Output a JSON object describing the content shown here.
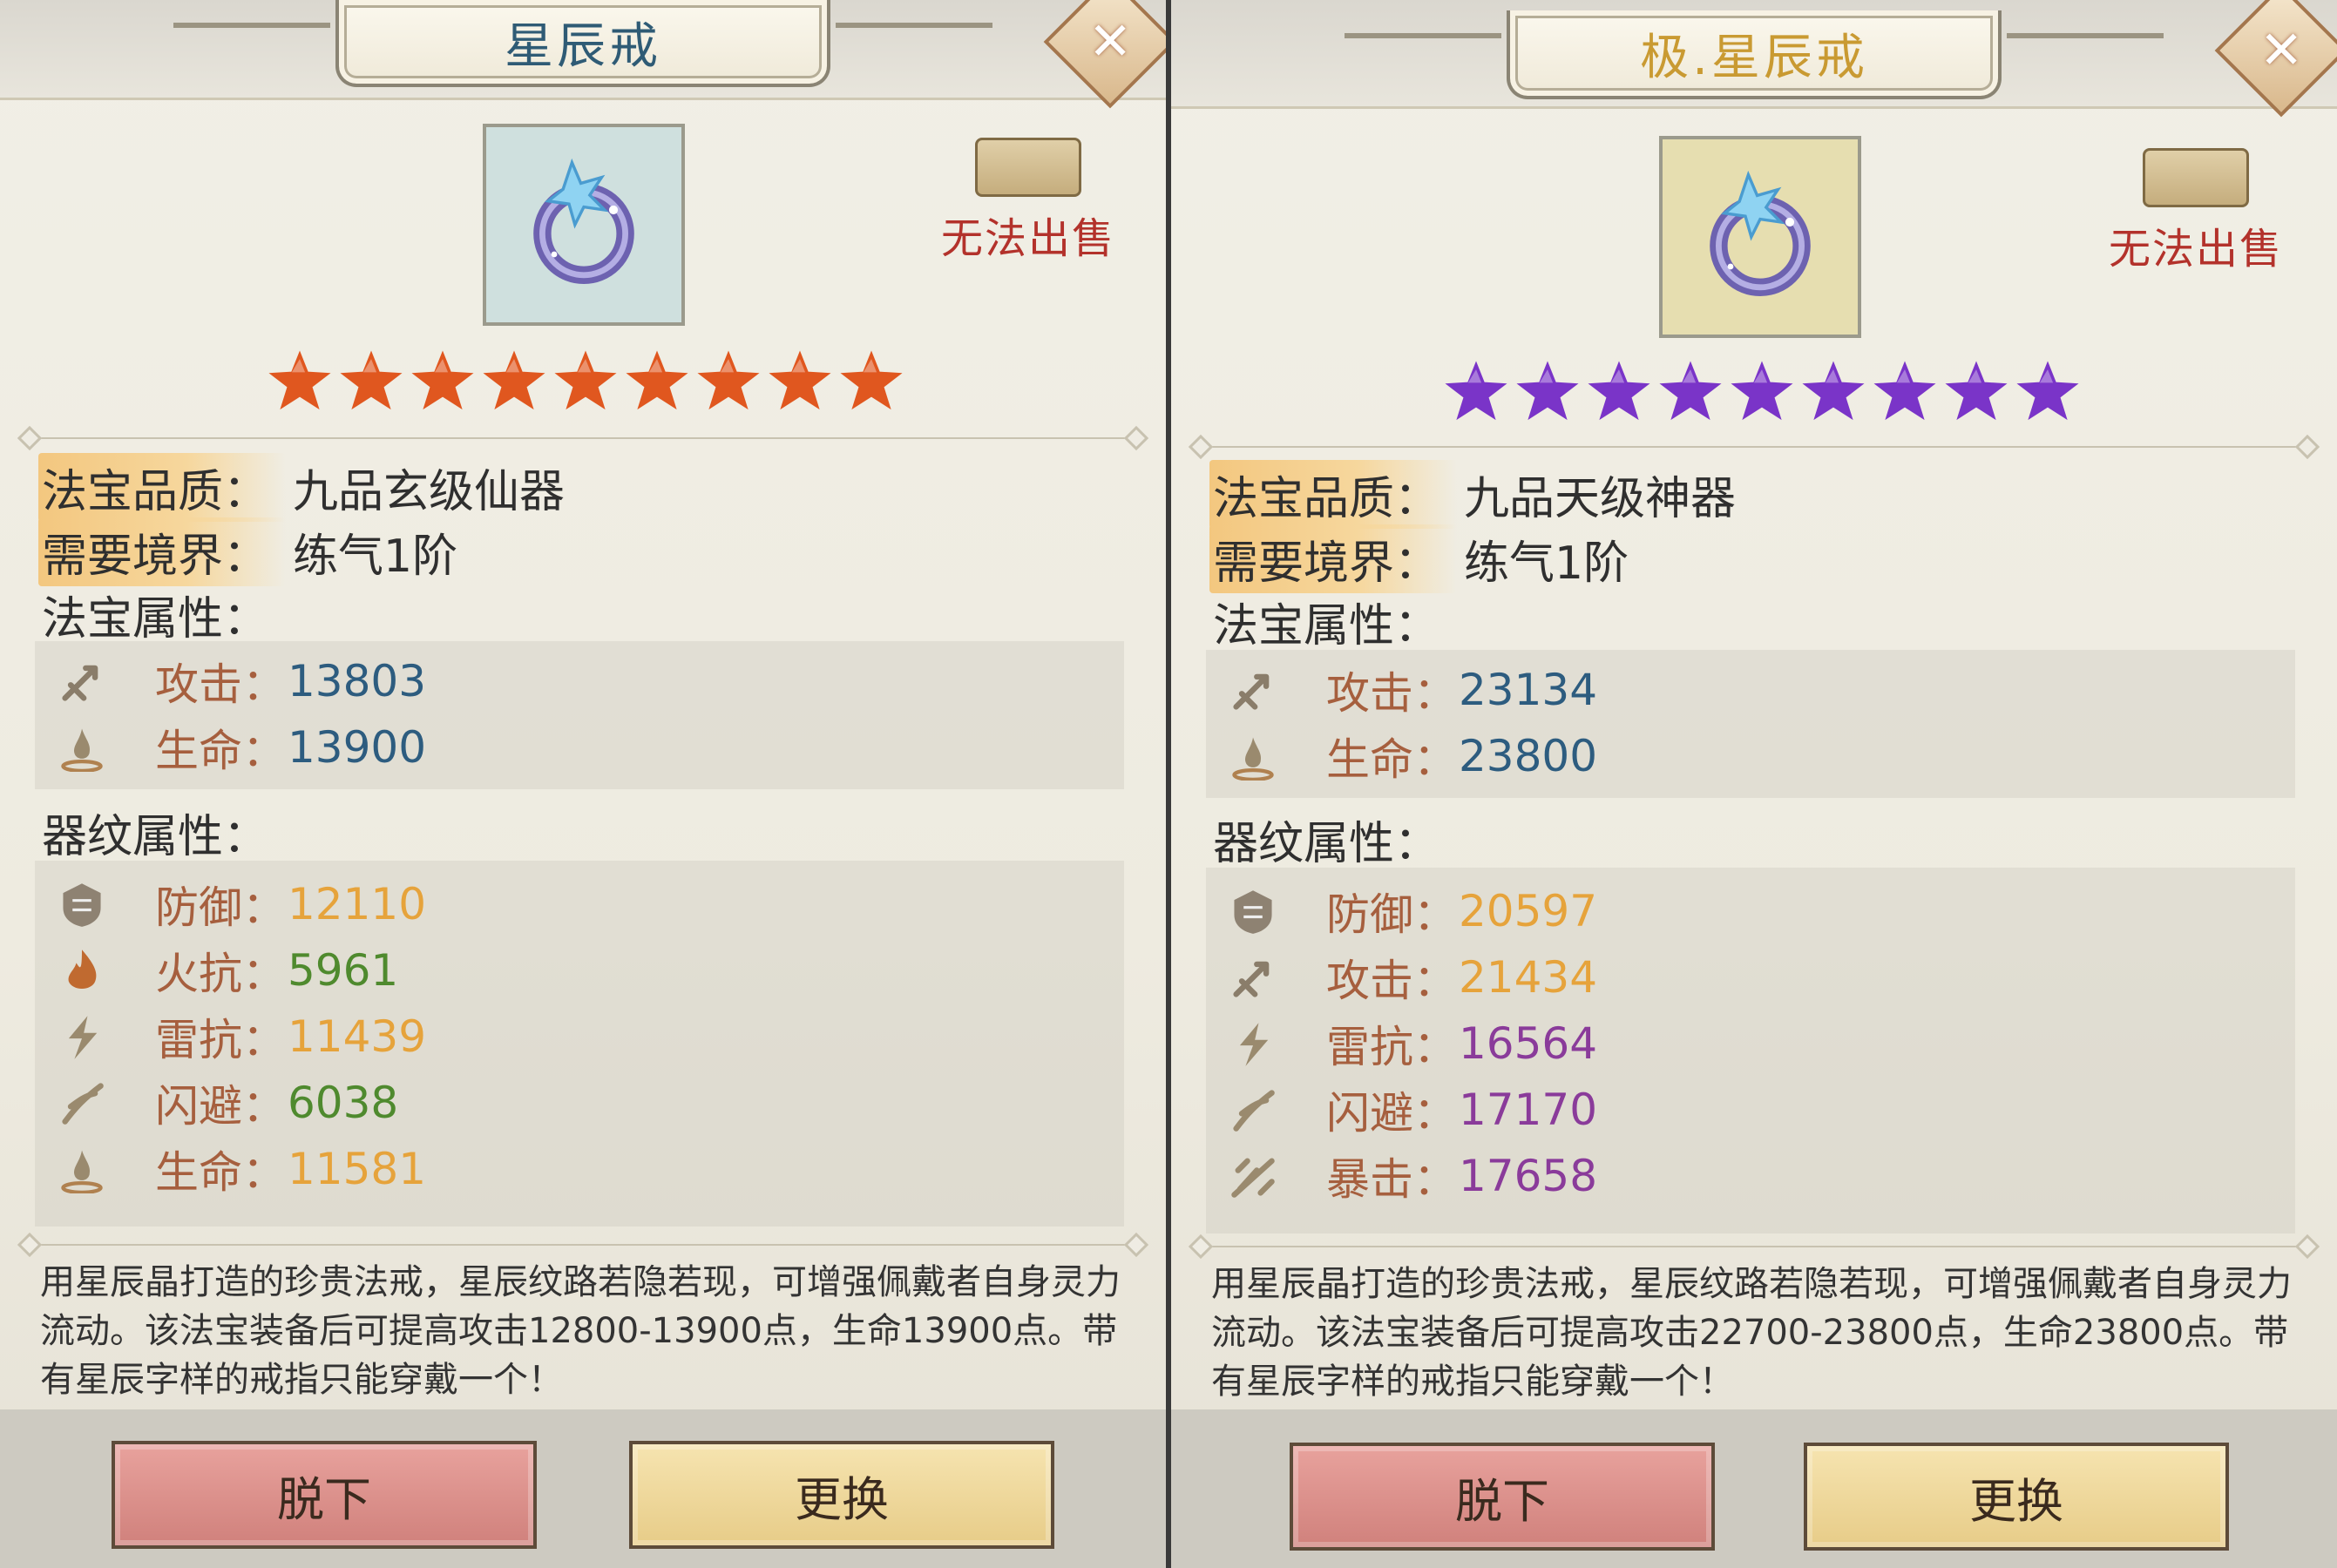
{
  "panels": [
    {
      "title": "星辰戒",
      "title_color": "#2f5b75",
      "icon_bg": "#cfe0de",
      "unsellable_label": "无法出售",
      "star_color": "#e0571f",
      "star_count": 9,
      "quality_label": "法宝品质：",
      "quality_value": "九品玄级仙器",
      "realm_label": "需要境界：",
      "realm_value": "练气1阶",
      "base_attr_title": "法宝属性：",
      "base_attrs": [
        {
          "icon": "attack-icon",
          "name": "攻击：",
          "value": "13803",
          "color": "#2d5c7f"
        },
        {
          "icon": "life-icon",
          "name": "生命：",
          "value": "13900",
          "color": "#2d5c7f"
        }
      ],
      "pattern_attr_title": "器纹属性：",
      "pattern_attrs": [
        {
          "icon": "defense-icon",
          "name": "防御：",
          "value": "12110",
          "color": "#e6a33b"
        },
        {
          "icon": "fire-resist-icon",
          "name": "火抗：",
          "value": "5961",
          "color": "#4f8a2e"
        },
        {
          "icon": "thunder-resist-icon",
          "name": "雷抗：",
          "value": "11439",
          "color": "#e6a33b"
        },
        {
          "icon": "dodge-icon",
          "name": "闪避：",
          "value": "6038",
          "color": "#4f8a2e"
        },
        {
          "icon": "life-icon",
          "name": "生命：",
          "value": "11581",
          "color": "#e6a33b"
        }
      ],
      "description": "用星辰晶打造的珍贵法戒，星辰纹路若隐若现，可增强佩戴者自身灵力流动。该法宝装备后可提高攻击12800-13900点，生命13900点。带有星辰字样的戒指只能穿戴一个！",
      "unequip_label": "脱下",
      "replace_label": "更换"
    },
    {
      "title": "极.星辰戒",
      "title_color": "#c99a32",
      "icon_bg": "#e6deb0",
      "unsellable_label": "无法出售",
      "star_color": "#7a34c8",
      "star_count": 9,
      "quality_label": "法宝品质：",
      "quality_value": "九品天级神器",
      "realm_label": "需要境界：",
      "realm_value": "练气1阶",
      "base_attr_title": "法宝属性：",
      "base_attrs": [
        {
          "icon": "attack-icon",
          "name": "攻击：",
          "value": "23134",
          "color": "#2d5c7f"
        },
        {
          "icon": "life-icon",
          "name": "生命：",
          "value": "23800",
          "color": "#2d5c7f"
        }
      ],
      "pattern_attr_title": "器纹属性：",
      "pattern_attrs": [
        {
          "icon": "defense-icon",
          "name": "防御：",
          "value": "20597",
          "color": "#e6a33b"
        },
        {
          "icon": "attack-icon",
          "name": "攻击：",
          "value": "21434",
          "color": "#e6a33b"
        },
        {
          "icon": "thunder-resist-icon",
          "name": "雷抗：",
          "value": "16564",
          "color": "#8a3b9a"
        },
        {
          "icon": "dodge-icon",
          "name": "闪避：",
          "value": "17170",
          "color": "#8a3b9a"
        },
        {
          "icon": "crit-icon",
          "name": "暴击：",
          "value": "17658",
          "color": "#8a3b9a"
        }
      ],
      "description": "用星辰晶打造的珍贵法戒，星辰纹路若隐若现，可增强佩戴者自身灵力流动。该法宝装备后可提高攻击22700-23800点，生命23800点。带有星辰字样的戒指只能穿戴一个！",
      "unequip_label": "脱下",
      "replace_label": "更换"
    }
  ]
}
